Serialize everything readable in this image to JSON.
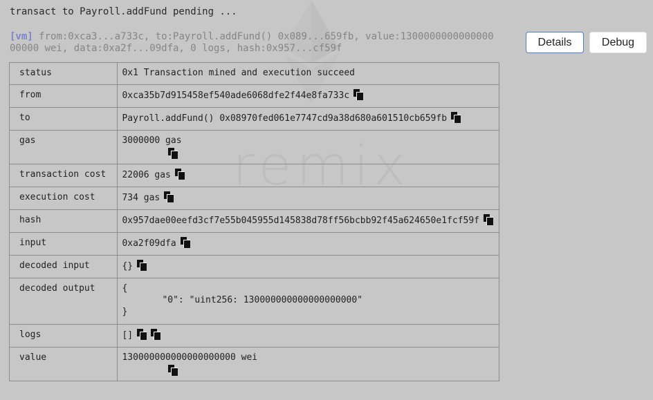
{
  "pending_text": "transact to Payroll.addFund pending ...",
  "summary": {
    "tag": "[vm]",
    "text": "from:0xca3...a733c, to:Payroll.addFund() 0x089...659fb, value:130000000000000000000 wei, data:0xa2f...09dfa, 0 logs, hash:0x957...cf59f"
  },
  "buttons": {
    "details": "Details",
    "debug": "Debug"
  },
  "watermark": "remix",
  "rows": {
    "status": {
      "key": "status",
      "value": "0x1 Transaction mined and execution succeed"
    },
    "from": {
      "key": "from",
      "value": "0xca35b7d915458ef540ade6068dfe2f44e8fa733c"
    },
    "to": {
      "key": "to",
      "value": "Payroll.addFund() 0x08970fed061e7747cd9a38d680a601510cb659fb"
    },
    "gas": {
      "key": "gas",
      "value": "3000000 gas"
    },
    "transaction_cost": {
      "key": "transaction cost",
      "value": "22006 gas"
    },
    "execution_cost": {
      "key": "execution cost",
      "value": "734 gas"
    },
    "hash": {
      "key": "hash",
      "value": "0x957dae00eefd3cf7e55b045955d145838d78ff56bcbb92f45a624650e1fcf59f"
    },
    "input": {
      "key": "input",
      "value": "0xa2f09dfa"
    },
    "decoded_input": {
      "key": "decoded input",
      "value": "{}"
    },
    "decoded_output": {
      "key": "decoded output",
      "open": "{",
      "inner": "\"0\": \"uint256: 130000000000000000000\"",
      "close": "}"
    },
    "logs": {
      "key": "logs",
      "value": "[]"
    },
    "value": {
      "key": "value",
      "value": "130000000000000000000 wei"
    }
  }
}
